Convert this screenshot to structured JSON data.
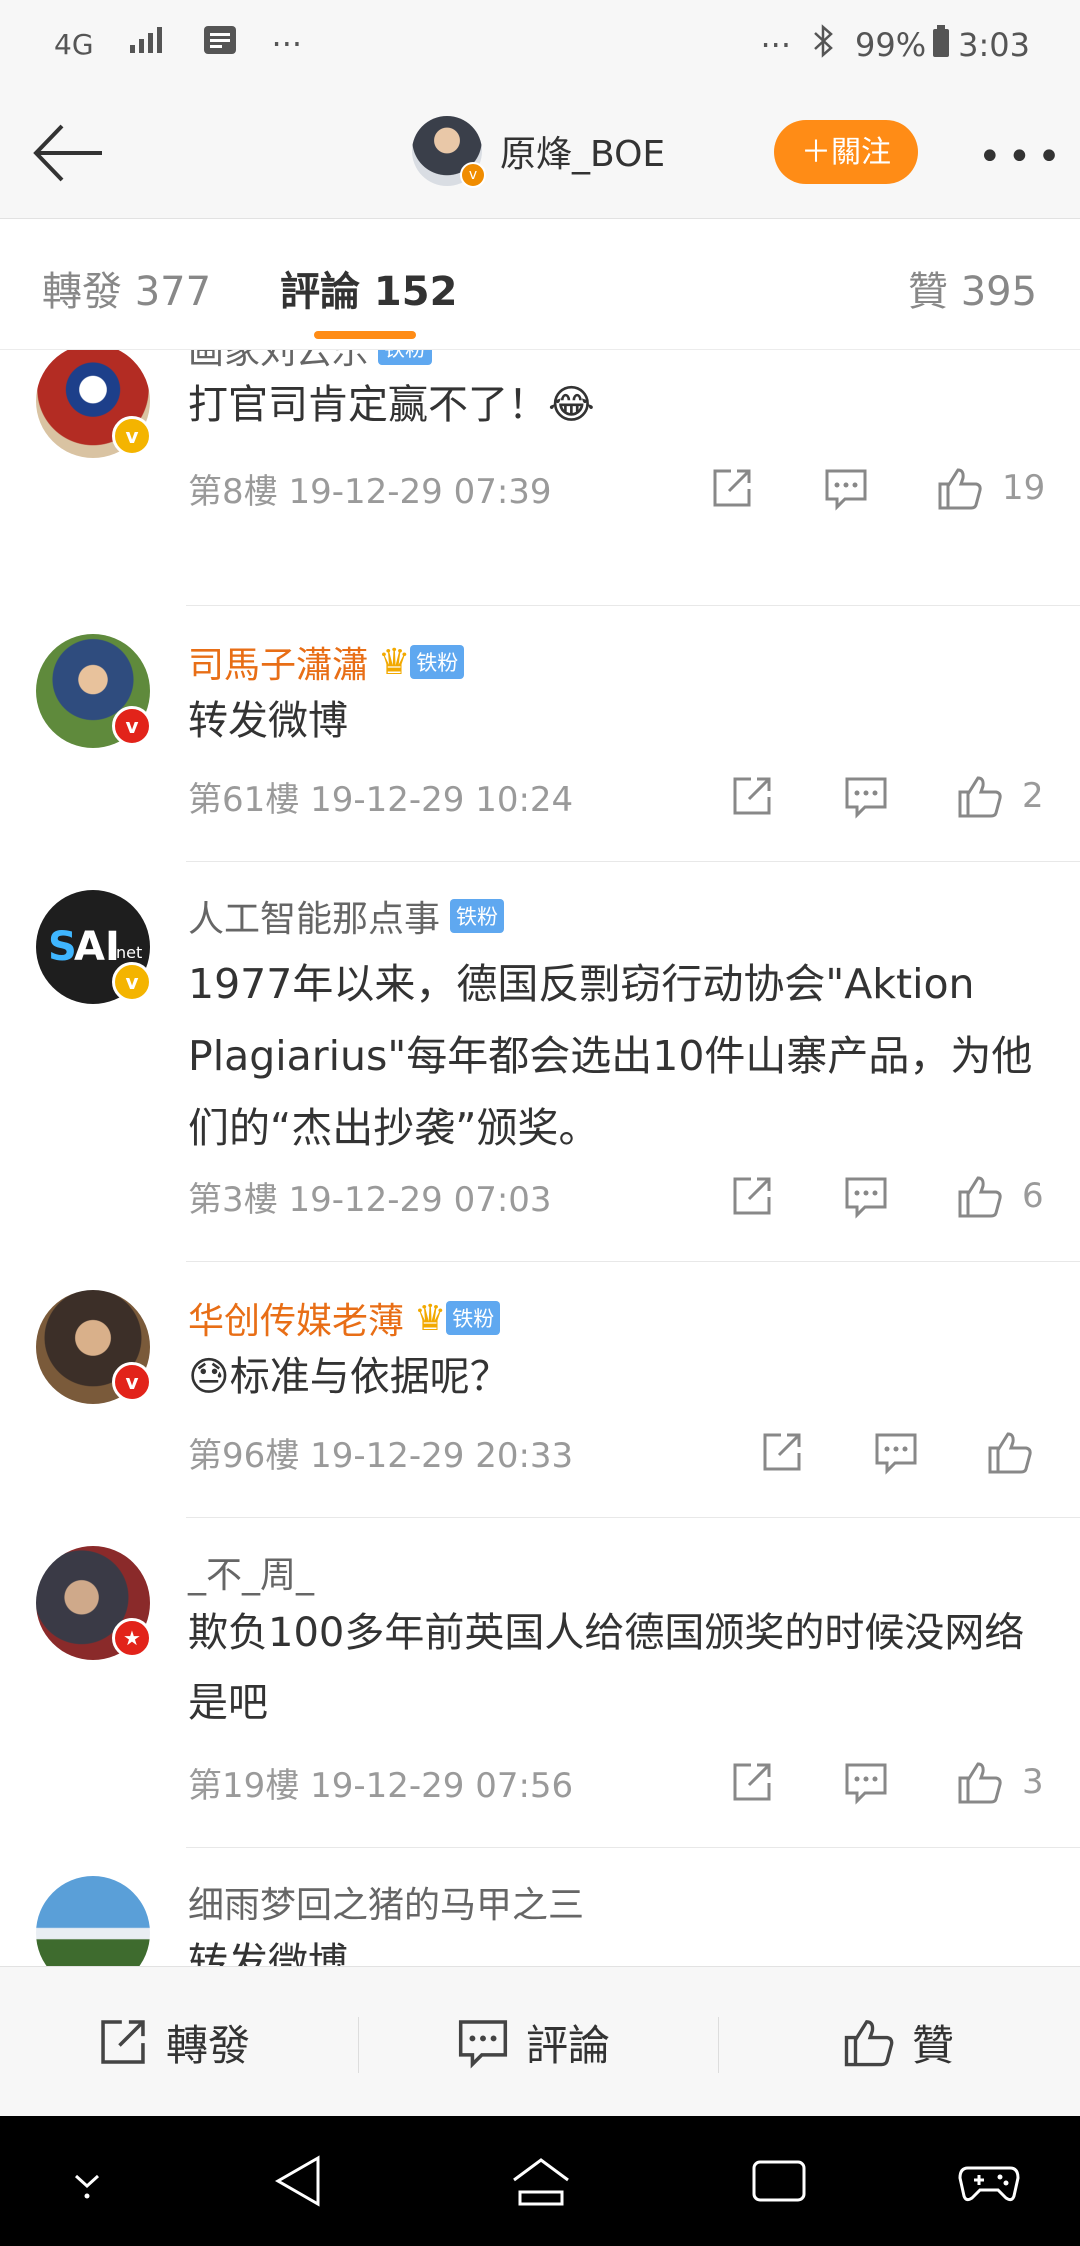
{
  "status_bar": {
    "network": "4G",
    "dots_left": "···",
    "dots_right": "···",
    "battery": "99%",
    "time": "3:03"
  },
  "nav": {
    "username": "原烽_BOE",
    "follow_label": "＋關注"
  },
  "tabs": [
    {
      "label": "轉發 377"
    },
    {
      "label": "評論 152"
    },
    {
      "label": "贊 395"
    }
  ],
  "comments": [
    {
      "name": "画家刘云乐",
      "badge": "铁粉",
      "crown": false,
      "content": "打官司肯定赢不了！😂",
      "meta": "第8樓  19-12-29 07:39",
      "likes": "19"
    },
    {
      "name": "司馬子瀟瀟",
      "badge": "铁粉",
      "crown": true,
      "content": "转发微博",
      "meta": "第61樓  19-12-29 10:24",
      "likes": "2"
    },
    {
      "name": "人工智能那点事",
      "badge": "铁粉",
      "crown": false,
      "content": "1977年以来，德国反剽窃行动协会\"Aktion Plagiarius\"每年都会选出10件山寨产品，为他们的“杰出抄袭”颁奖。",
      "meta": "第3樓  19-12-29 07:03",
      "likes": "6"
    },
    {
      "name": "华创传媒老薄",
      "badge": "铁粉",
      "crown": true,
      "content": "😓标准与依据呢？",
      "meta": "第96樓  19-12-29 20:33",
      "likes": ""
    },
    {
      "name": "_不_周_",
      "badge": "",
      "crown": false,
      "content": "欺负100多年前英国人给德国颁奖的时候没网络是吧",
      "meta": "第19樓  19-12-29 07:56",
      "likes": "3"
    },
    {
      "name": "细雨梦回之猪的马甲之三",
      "badge": "",
      "crown": false,
      "content": "转发微博",
      "meta": "",
      "likes": ""
    }
  ],
  "bottom_bar": {
    "repost": "轉發",
    "comment": "評論",
    "like": "贊"
  },
  "colors": {
    "accent": "#ff8c16",
    "orange_name": "#e86e16",
    "fan_badge": "#5fa8f0"
  }
}
